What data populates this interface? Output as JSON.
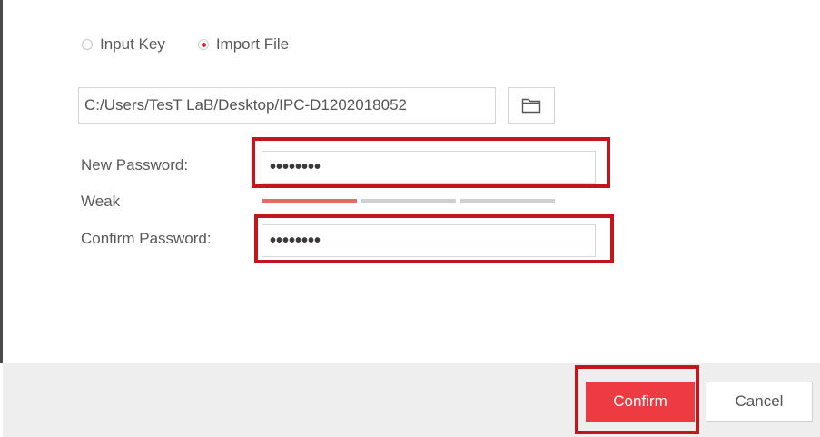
{
  "import_mode": {
    "options": [
      {
        "label": "Input Key",
        "selected": false
      },
      {
        "label": "Import File",
        "selected": true
      }
    ]
  },
  "file": {
    "path": "C:/Users/TesT LaB/Desktop/IPC-D1202018052",
    "browse_icon": "folder-icon"
  },
  "new_password": {
    "label": "New Password:",
    "value": "••••••••"
  },
  "strength": {
    "label": "Weak",
    "level": 1,
    "max_level": 3
  },
  "confirm_password": {
    "label": "Confirm Password:",
    "value": "••••••••"
  },
  "footer": {
    "confirm_label": "Confirm",
    "cancel_label": "Cancel"
  },
  "colors": {
    "accent": "#ee3b43",
    "highlight": "#c2161c",
    "weak_meter": "#e56a6a"
  }
}
